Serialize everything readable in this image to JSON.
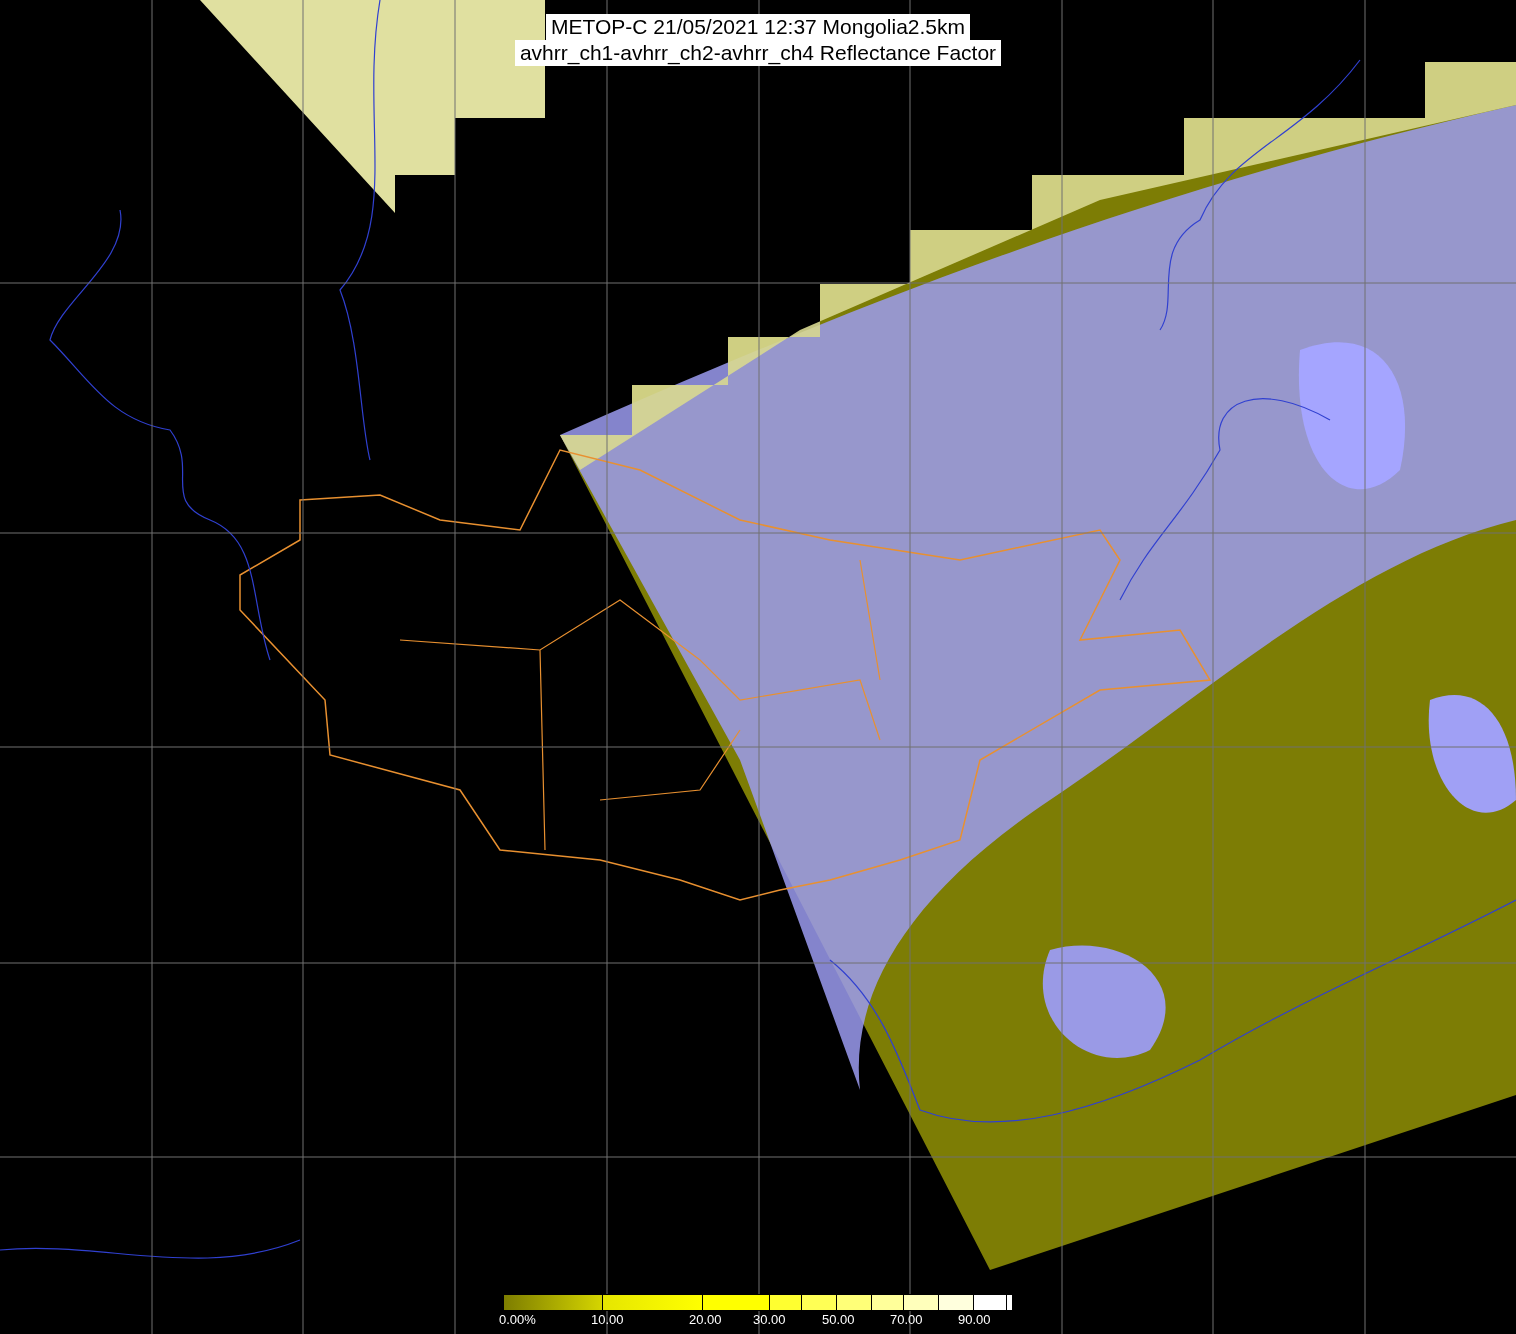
{
  "title_lines": [
    "METOP-C 21/05/2021 12:37 Mongolia2.5km",
    "avhrr_ch1-avhrr_ch2-avhrr_ch4 Reflectance Factor"
  ],
  "colorbar": {
    "labels": [
      "0.00%",
      "10.00",
      "20.00",
      "30.00",
      "50.00",
      "70.00",
      "90.00"
    ]
  }
}
